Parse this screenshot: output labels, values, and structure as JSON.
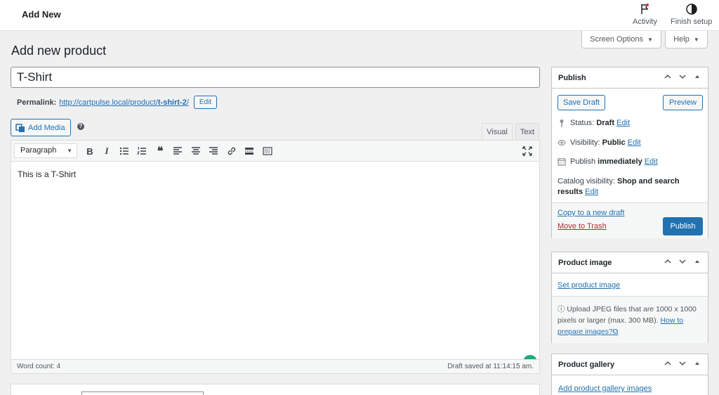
{
  "topbar": {
    "title": "Add New",
    "activity_label": "Activity",
    "finish_label": "Finish setup"
  },
  "screen_meta": {
    "screen_options": "Screen Options",
    "help": "Help"
  },
  "page": {
    "title": "Add new product"
  },
  "post": {
    "title_value": "T-Shirt",
    "permalink_label": "Permalink:",
    "permalink_base": "http://cartpulse.local/product/",
    "permalink_slug": "t-shirt-2",
    "permalink_trail": "/",
    "permalink_edit": "Edit"
  },
  "editor": {
    "add_media": "Add Media",
    "help_glyph": "?",
    "tab_visual": "Visual",
    "tab_text": "Text",
    "format_select": "Paragraph",
    "content": "This is a T-Shirt",
    "word_count": "Word count: 4",
    "draft_saved": "Draft saved at 11:14:15 am."
  },
  "publish_box": {
    "title": "Publish",
    "save_draft": "Save Draft",
    "preview": "Preview",
    "status_label": "Status:",
    "status_value": "Draft",
    "status_edit": "Edit",
    "visibility_label": "Visibility:",
    "visibility_value": "Public",
    "visibility_edit": "Edit",
    "publish_label": "Publish",
    "publish_value": "immediately",
    "publish_edit": "Edit",
    "catalog_label": "Catalog visibility:",
    "catalog_value": "Shop and search results",
    "catalog_edit": "Edit",
    "copy_draft": "Copy to a new draft",
    "trash": "Move to Trash",
    "publish_button": "Publish"
  },
  "product_image_box": {
    "title": "Product image",
    "set_link": "Set product image",
    "info_text": "Upload JPEG files that are 1000 x 1000 pixels or larger (max. 300 MB).",
    "info_link": "How to prepare images?"
  },
  "gallery_box": {
    "title": "Product gallery",
    "add_link": "Add product gallery images"
  },
  "colors": {
    "accent": "#2271b1",
    "danger": "#b32d2e",
    "loader": "#1ea97c"
  }
}
